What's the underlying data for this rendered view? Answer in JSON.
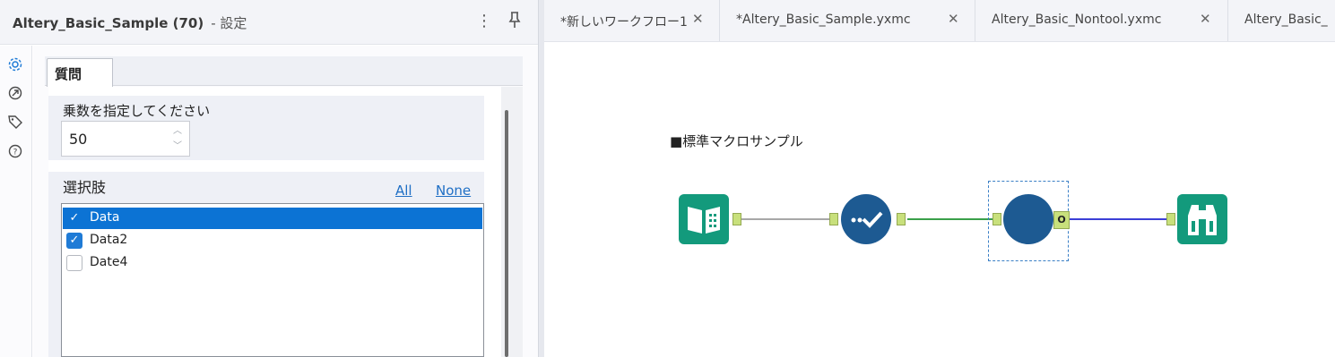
{
  "panel": {
    "title": "Altery_Basic_Sample (70)",
    "subtitle": "- 設定",
    "more_icon": "vertical-ellipsis-icon",
    "pin_icon": "pin-icon"
  },
  "side_icons": [
    "gear-icon",
    "arrow-circle-icon",
    "tag-icon",
    "help-circle-icon"
  ],
  "config": {
    "tab_label": "質問",
    "numeric_question": {
      "label": "乗数を指定してください",
      "value": "50"
    },
    "list_question": {
      "label": "選択肢",
      "all_label": "All",
      "none_label": "None",
      "items": [
        {
          "label": "Data",
          "checked": true,
          "selected": true
        },
        {
          "label": "Data2",
          "checked": true,
          "selected": false
        },
        {
          "label": "Date4",
          "checked": false,
          "selected": false
        }
      ]
    }
  },
  "doc_tabs": [
    {
      "label": "*新しいワークフロー1",
      "close": "✕"
    },
    {
      "label": "*Altery_Basic_Sample.yxmc",
      "close": "✕"
    },
    {
      "label": "Altery_Basic_Nontool.yxmc",
      "close": "✕"
    },
    {
      "label": "Altery_Basic_",
      "close": ""
    }
  ],
  "canvas": {
    "comment": "■標準マクロサンプル",
    "output_anchor_label": "O",
    "tools": [
      "input-data-tool-icon",
      "macro-input-tool-icon",
      "macro-tool-icon",
      "browse-tool-icon"
    ]
  },
  "colors": {
    "tool_teal": "#139a7c",
    "tool_blue": "#1d5a92",
    "anchor_green": "#c8e07c",
    "conn_gray": "#a7a7a7",
    "conn_green": "#3aa04a",
    "conn_blue": "#3b3fd6",
    "selected_row": "#0c73d4"
  }
}
